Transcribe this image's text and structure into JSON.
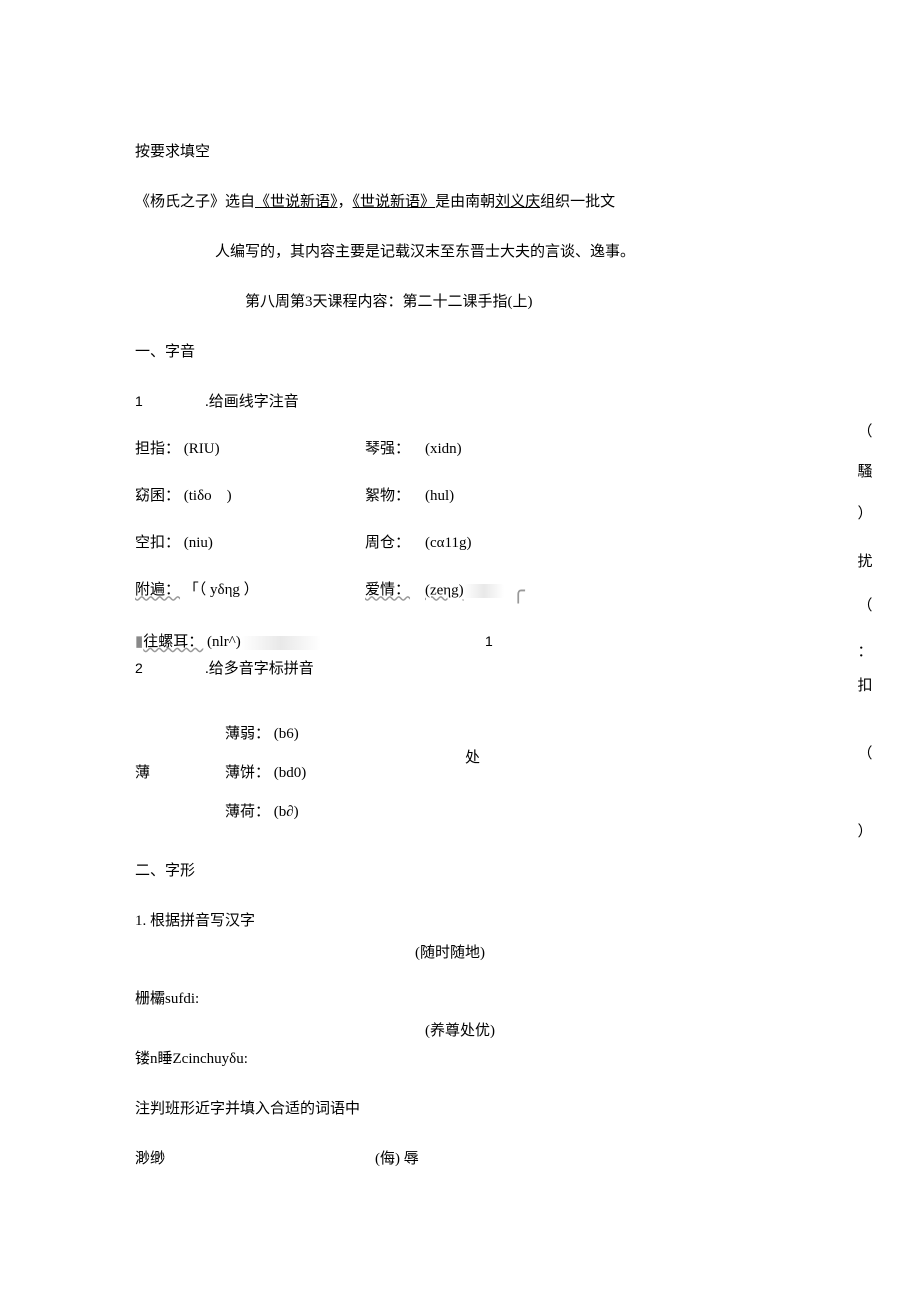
{
  "title_line": "按要求填空",
  "intro": {
    "pre": "《杨氏之子》选自",
    "book1": "《世说新语》",
    "mid": "，",
    "book2": "《世说新语》",
    "after1": "是由南朝",
    "author": "刘义庆",
    "after2": "组织一批文"
  },
  "intro_cont": "人编写的，其内容主要是记载汉末至东晋士大夫的言谈、逸事。",
  "lesson_header": "第八周第3天课程内容：第二十二课手指(上)",
  "section1": "一、字音",
  "item1_num": "1",
  "item1_text": ".给画线字注音",
  "pinyin_rows": [
    {
      "a_label": "担指：",
      "a_val": "(RIU)",
      "b_label": "琴强：",
      "b_val": "(xidn)"
    },
    {
      "a_label": "窈囷：",
      "a_val": "(tiδo",
      "a_close": ")",
      "b_label": "絮物：",
      "b_val": "(hul)"
    },
    {
      "a_label": "空扣：",
      "a_val": "(niu)",
      "b_label": "周仓：",
      "b_val": "(cα11g)"
    },
    {
      "a_label": "附遍：",
      "a_val": "「（  yδηg  ）",
      "b_label": "爱情：",
      "b_val": "(zeηg)"
    },
    {
      "a_label": "往螺耳：",
      "a_val": "(nlr^)",
      "b_label": "",
      "b_val": ""
    }
  ],
  "right_side": [
    "（",
    "騷",
    "）",
    "扰",
    "（",
    "：",
    "扣",
    "（",
    "）"
  ],
  "right_side_1": "1",
  "item2_num": "2",
  "item2_text": ".给多音字标拼音",
  "bo": {
    "head": "薄",
    "rows": [
      {
        "label": "薄弱：",
        "val": "(b6)"
      },
      {
        "label": "薄饼：",
        "val": "(bd0)"
      },
      {
        "label": "薄荷：",
        "val": "(b∂)"
      }
    ]
  },
  "chu_word": "处",
  "section2": "二、字形",
  "shape1": "1. 根据拼音写汉字",
  "shape_rows": [
    {
      "left": "栅欛sufdi:",
      "right": "(随时随地)"
    },
    {
      "left": "镂n睡Zcinchuyδu:",
      "right": "(养尊处优)"
    }
  ],
  "shape_note": "注判班形近字并填入合适的词语中",
  "bottom_left": "渺缈",
  "bottom_right": "(侮) 辱"
}
